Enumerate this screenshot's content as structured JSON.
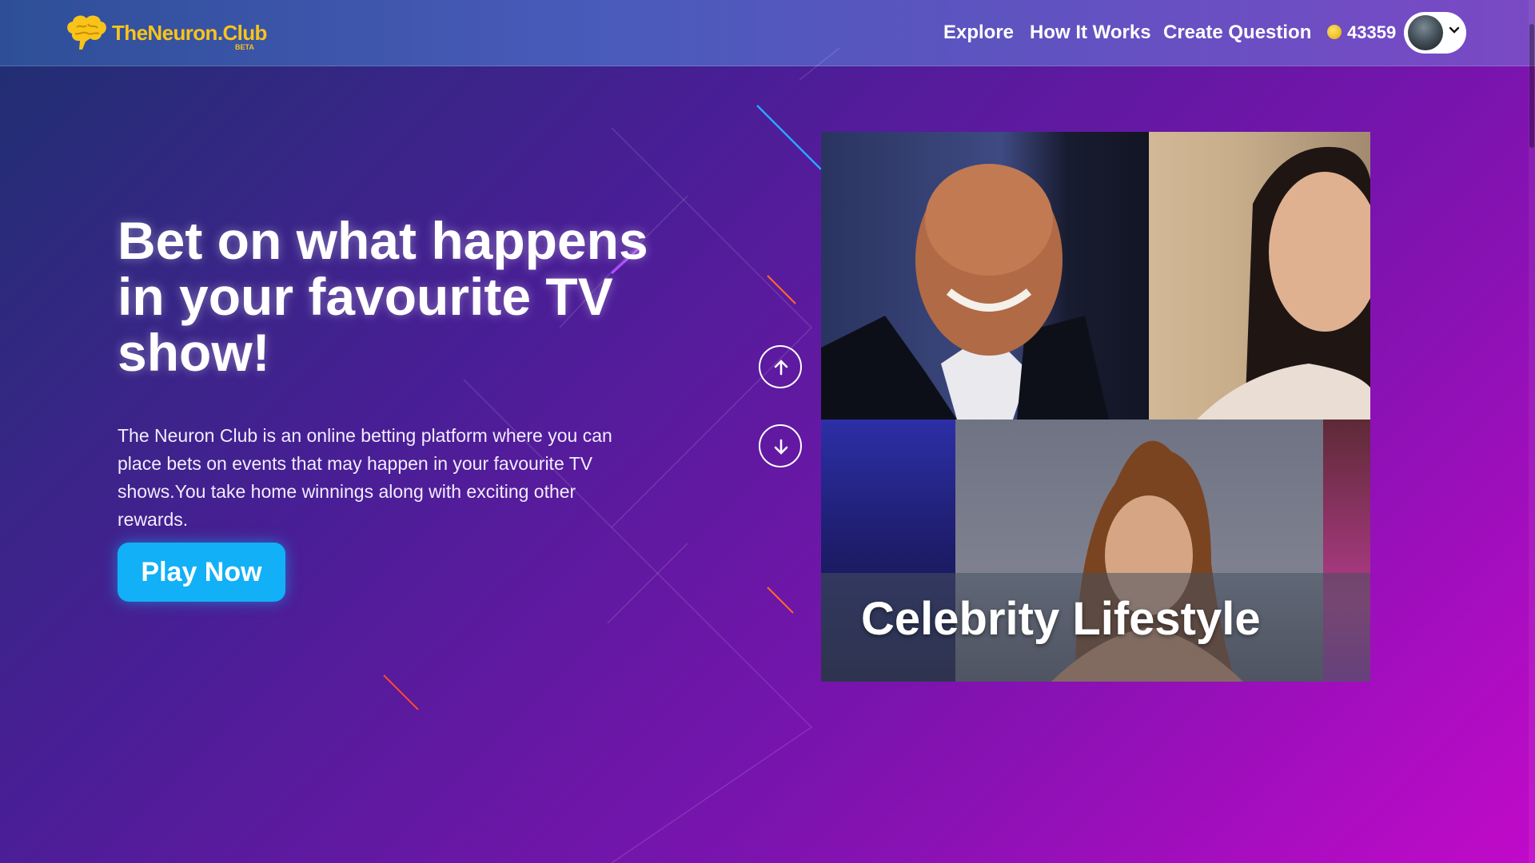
{
  "header": {
    "logo_text": "TheNeuron.Club",
    "logo_badge": "BETA",
    "nav": [
      {
        "label": "Explore"
      },
      {
        "label": "How It Works"
      },
      {
        "label": "Create Question"
      }
    ],
    "coins": "43359"
  },
  "hero": {
    "title": "Bet on what happens in your favourite TV show!",
    "description": "The Neuron Club is an online betting platform where you can place bets on events that may happen in your favourite TV shows.You take home winnings along with exciting other rewards.",
    "cta_label": "Play Now"
  },
  "carousel": {
    "caption": "Celebrity Lifestyle"
  },
  "colors": {
    "accent": "#12b0f6",
    "logo": "#f8c41a",
    "bg_start": "#1e3070",
    "bg_end": "#c10ac9"
  }
}
